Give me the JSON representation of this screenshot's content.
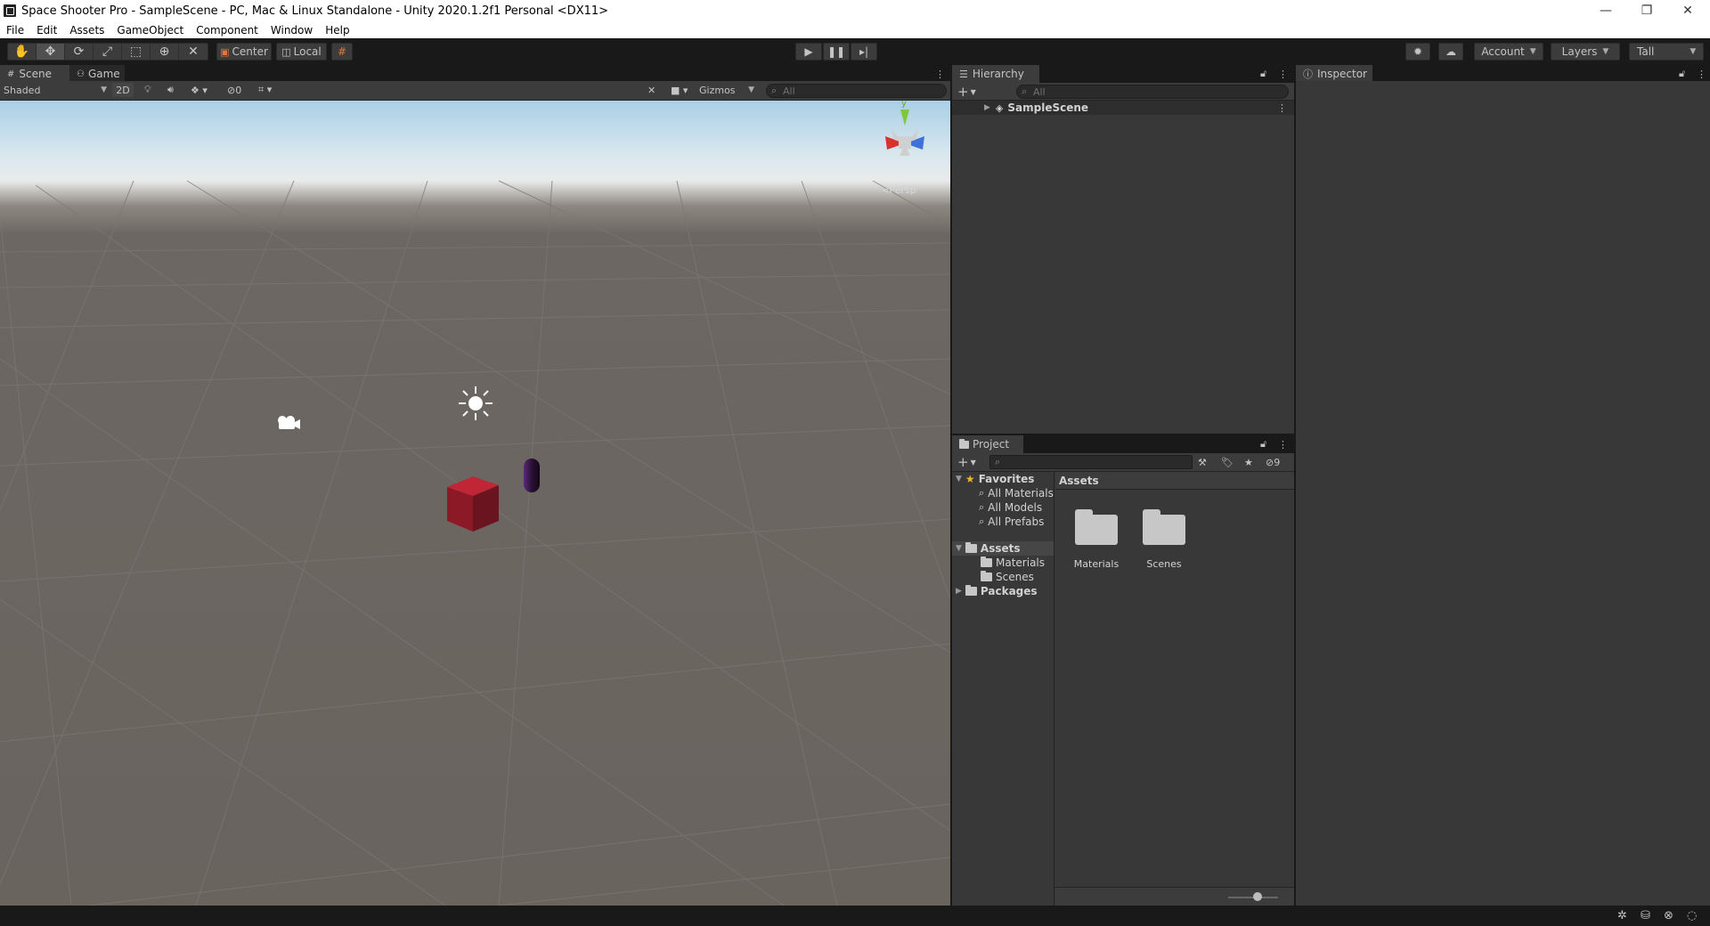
{
  "window": {
    "title": "Space Shooter Pro - SampleScene - PC, Mac & Linux Standalone - Unity 2020.1.2f1 Personal <DX11>",
    "controls": [
      "minimize",
      "restore",
      "close"
    ]
  },
  "menu": [
    "File",
    "Edit",
    "Assets",
    "GameObject",
    "Component",
    "Window",
    "Help"
  ],
  "toolbar": {
    "tools": [
      "hand-tool",
      "move-tool",
      "rotate-tool",
      "scale-tool",
      "rect-tool",
      "transform-tool",
      "custom-tool"
    ],
    "pivot_label": "Center",
    "space_label": "Local",
    "account_label": "Account",
    "layers_label": "Layers",
    "layout_label": "Tall"
  },
  "scene": {
    "tabs": [
      "Scene",
      "Game"
    ],
    "shading_mode": "Shaded",
    "mode_2d": "2D",
    "hidden_count": "0",
    "gizmos_label": "Gizmos",
    "search_placeholder": "All",
    "persp_label": "Persp",
    "gizmo_axis_y": "y"
  },
  "hierarchy": {
    "title": "Hierarchy",
    "search_placeholder": "All",
    "root": "SampleScene"
  },
  "project": {
    "title": "Project",
    "hidden_count": "9",
    "favorites_label": "Favorites",
    "favorites": [
      "All Materials",
      "All Models",
      "All Prefabs"
    ],
    "assets_label": "Assets",
    "asset_folders": [
      "Materials",
      "Scenes"
    ],
    "packages_label": "Packages",
    "breadcrumb": "Assets",
    "grid_items": [
      "Materials",
      "Scenes"
    ]
  },
  "inspector": {
    "title": "Inspector"
  },
  "colors": {
    "editor_bg": "#191919",
    "panel_bg": "#383838",
    "tab_active": "#3c3c3c",
    "cube": "#9b1c2b",
    "capsule": "#3a1848"
  }
}
